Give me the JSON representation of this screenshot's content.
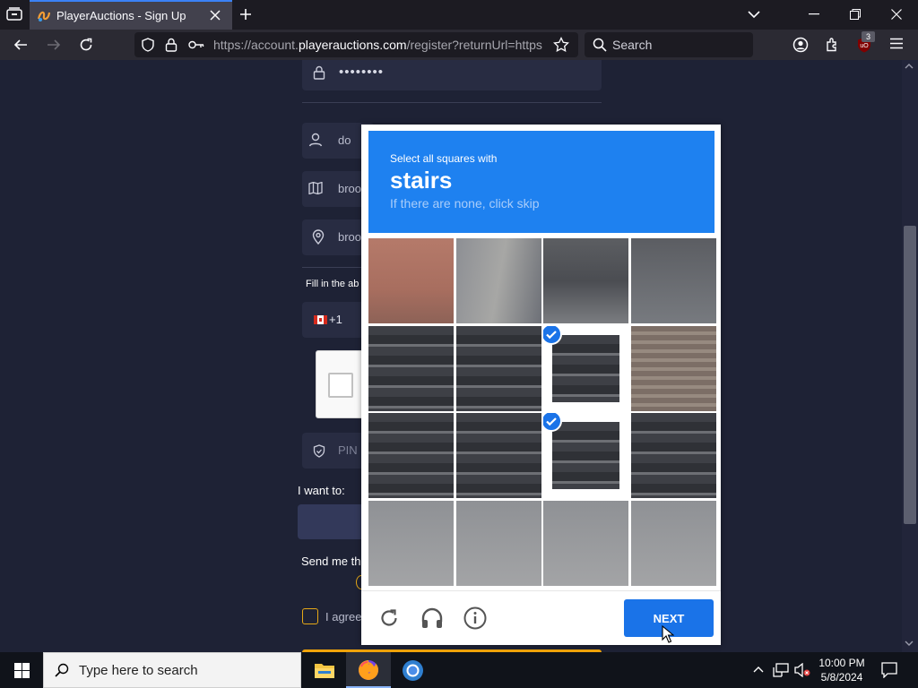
{
  "browser": {
    "tab_title": "PlayerAuctions - Sign Up",
    "url_domain_prefix": "https://account.",
    "url_domain": "playerauctions.com",
    "url_rest": "/register?returnUrl=https",
    "search_placeholder": "Search",
    "extension_badge": "3"
  },
  "form": {
    "password_mask": "••••••••",
    "username_partial": "do",
    "address_partial": "broo",
    "city_partial": "broo",
    "fill_in_partial": "Fill in the ab",
    "phone_code": "+1",
    "pin_placeholder": "PIN",
    "i_want_to": "I want to:",
    "send_me_partial": "Send me th",
    "agree_partial": "I agree"
  },
  "captcha": {
    "instruction": "Select all squares with",
    "keyword": "stairs",
    "hint": "If there are none, click skip",
    "next_label": "NEXT",
    "accent_color": "#1e81f0",
    "grid": [
      [
        false,
        false,
        false,
        false
      ],
      [
        false,
        false,
        true,
        false
      ],
      [
        false,
        false,
        true,
        false
      ],
      [
        false,
        false,
        false,
        false
      ]
    ]
  },
  "taskbar": {
    "search_placeholder": "Type here to search",
    "time": "10:00 PM",
    "date": "5/8/2024"
  }
}
